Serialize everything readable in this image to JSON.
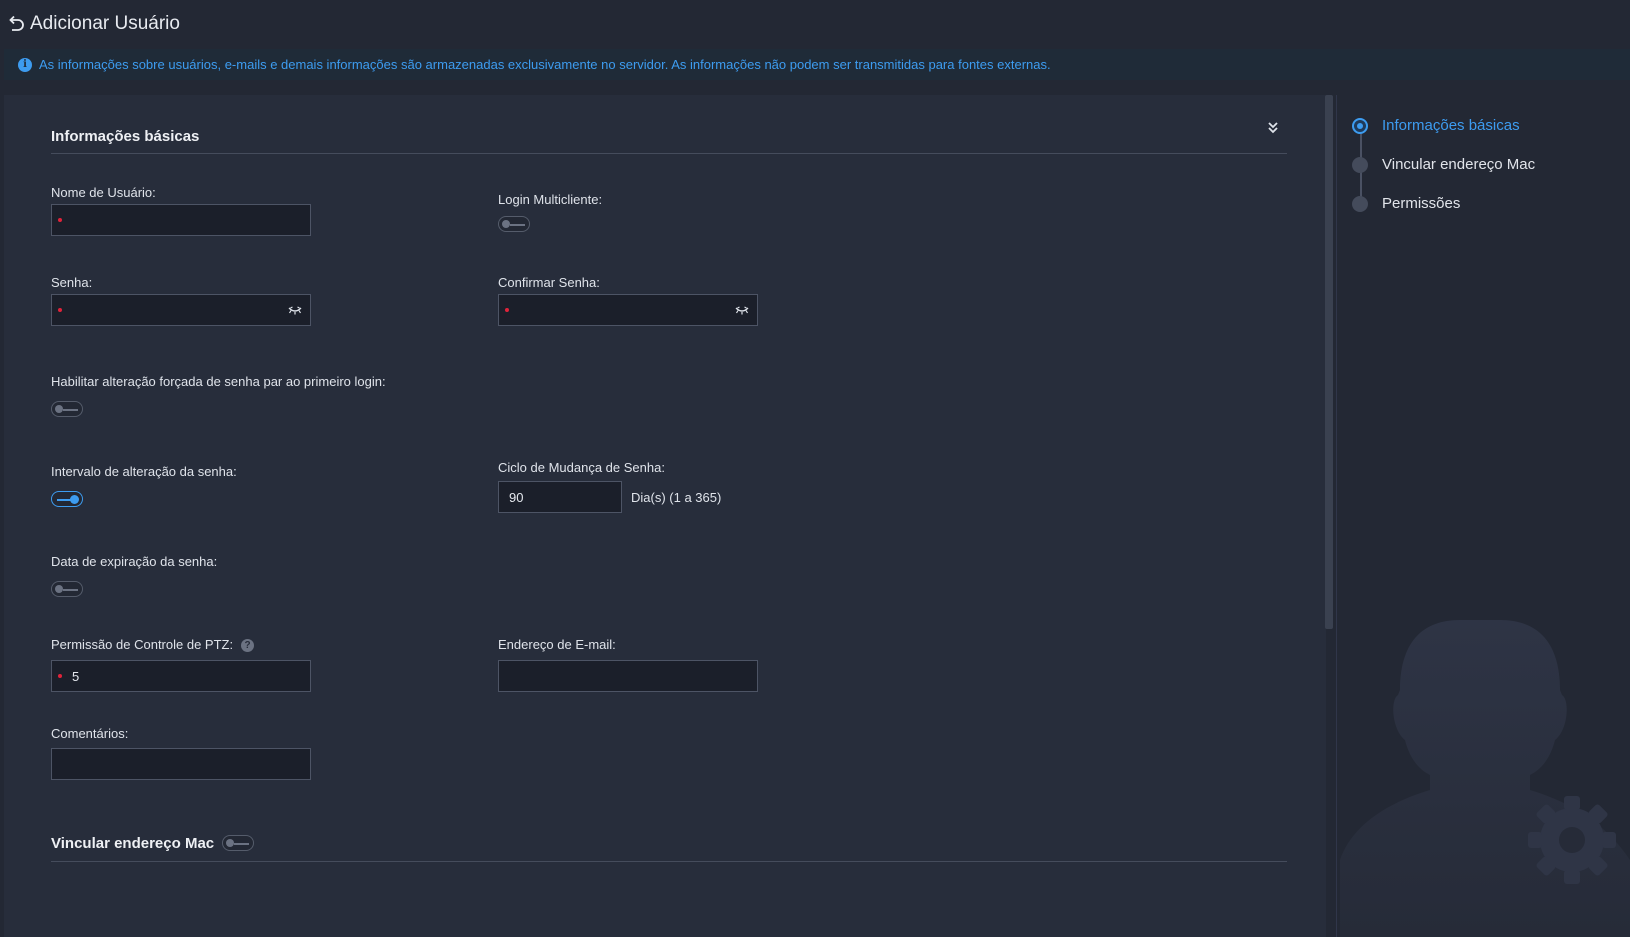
{
  "header": {
    "title": "Adicionar Usuário"
  },
  "info_banner": {
    "text": "As informações sobre usuários, e-mails e demais informações são armazenadas exclusivamente no servidor. As informações não podem ser transmitidas para fontes externas."
  },
  "basic_section": {
    "title": "Informações básicas",
    "username_label": "Nome de Usuário:",
    "multiclient_label": "Login Multicliente:",
    "password_label": "Senha:",
    "confirm_password_label": "Confirmar Senha:",
    "force_change_label": "Habilitar alteração forçada de senha par ao primeiro login:",
    "interval_label": "Intervalo de alteração da senha:",
    "cycle_label": "Ciclo de Mudança de Senha:",
    "cycle_value": "90",
    "cycle_unit": "Dia(s) (1 a 365)",
    "expiry_label": "Data de expiração da senha:",
    "ptz_label": "Permissão de Controle de PTZ:",
    "ptz_value": "5",
    "email_label": "Endereço de E-mail:",
    "comments_label": "Comentários:"
  },
  "toggles": {
    "multiclient": false,
    "force_change": false,
    "interval": true,
    "expiry": false,
    "mac_bind": false
  },
  "mac_section": {
    "title": "Vincular endereço Mac"
  },
  "nav": {
    "items": [
      {
        "label": "Informações básicas",
        "active": true
      },
      {
        "label": "Vincular endereço Mac",
        "active": false
      },
      {
        "label": "Permissões",
        "active": false
      }
    ]
  },
  "colors": {
    "accent": "#3d9cf0",
    "background": "#232834",
    "panel": "#272d3b",
    "required": "#e0233a"
  }
}
